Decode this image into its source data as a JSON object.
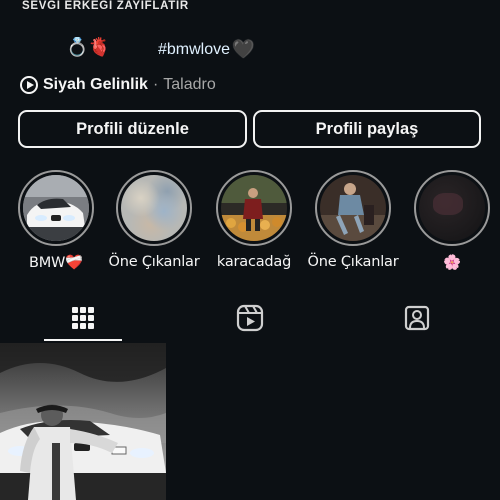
{
  "profile": {
    "bio_title": "SEVGI ERKEGI ZAYIFLATIR",
    "bio_emojis": "💍🫀",
    "hashtag": "#bmwlove",
    "hashtag_heart": "🖤",
    "music": {
      "song": "Siyah Gelinlik",
      "separator": "·",
      "artist": "Taladro",
      "icon": "play-circle-icon"
    }
  },
  "actions": {
    "edit_label": "Profili düzenle",
    "share_label": "Profili paylaş"
  },
  "highlights": [
    {
      "label": "BMW❤️‍🩹"
    },
    {
      "label": "Öne Çıkanlar"
    },
    {
      "label": "karacadağ"
    },
    {
      "label": "Öne Çıkanlar"
    },
    {
      "label": "🌸"
    }
  ],
  "tabs": [
    {
      "name": "grid",
      "icon": "grid-icon",
      "active": true
    },
    {
      "name": "reels",
      "icon": "reels-icon",
      "active": false
    },
    {
      "name": "tagged",
      "icon": "tagged-person-icon",
      "active": false
    }
  ],
  "colors": {
    "background": "#0c1014",
    "text": "#f5f5f5",
    "secondary_text": "#a8a8a8",
    "ring": "#9a9a9a"
  }
}
